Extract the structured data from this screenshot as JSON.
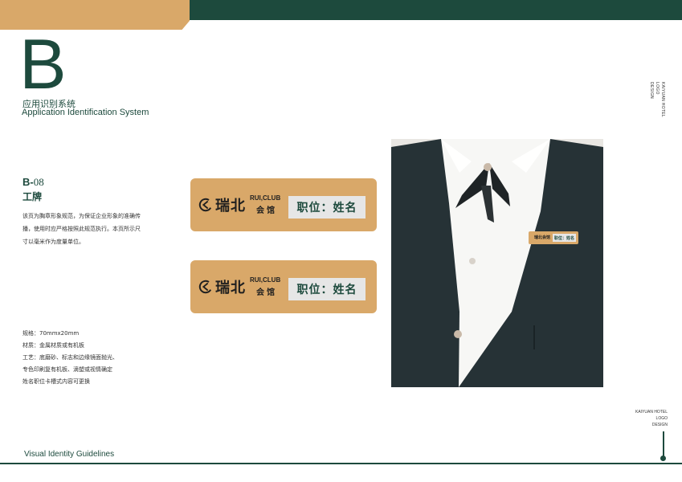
{
  "header": {
    "letter": "B",
    "system_cn": "应用识别系统",
    "system_en": "Application Identification System"
  },
  "side_brand": {
    "lines": [
      "KAIYUAN HOTEL",
      "LOGO",
      "DESIGN"
    ]
  },
  "section": {
    "code_prefix": "B-",
    "code_number": "08",
    "title": "工牌",
    "description": [
      "该页为胸章形象规范，为保证企业形象的准确传",
      "播，使用时应严格按照此规范执行。本页所示尺",
      "寸以毫米作为度量单位。"
    ],
    "specs": [
      "规格：70mmx20mm",
      "材质：金属材质或有机板",
      "工艺：底磨砂、标志和边缘镜面抛光、",
      "专色印刷复有机板、滴塑或视情确定",
      "姓名职位卡槽式内容可更换"
    ]
  },
  "badges": [
    {
      "brand_cn": "瑞北",
      "brand_en": "RUI,CLUB",
      "brand_cn2": "会馆",
      "name_text": "职位：姓名"
    },
    {
      "brand_cn": "瑞北",
      "brand_en": "RUI,CLUB",
      "brand_cn2": "会馆",
      "name_text": "职位：姓名"
    }
  ],
  "photo_badge": {
    "brand_cn": "瑞北会馆",
    "name_text": "职位：姓名"
  },
  "bottom_brand": {
    "lines": [
      "KAIYUAN HOTEL",
      "LOGO",
      "DESIGN"
    ]
  },
  "footer": {
    "text": "Visual Identity Guidelines"
  },
  "colors": {
    "brand_green": "#1d4a3d",
    "brand_tan": "#d9a869",
    "badge_plate": "#e6e6e6"
  }
}
